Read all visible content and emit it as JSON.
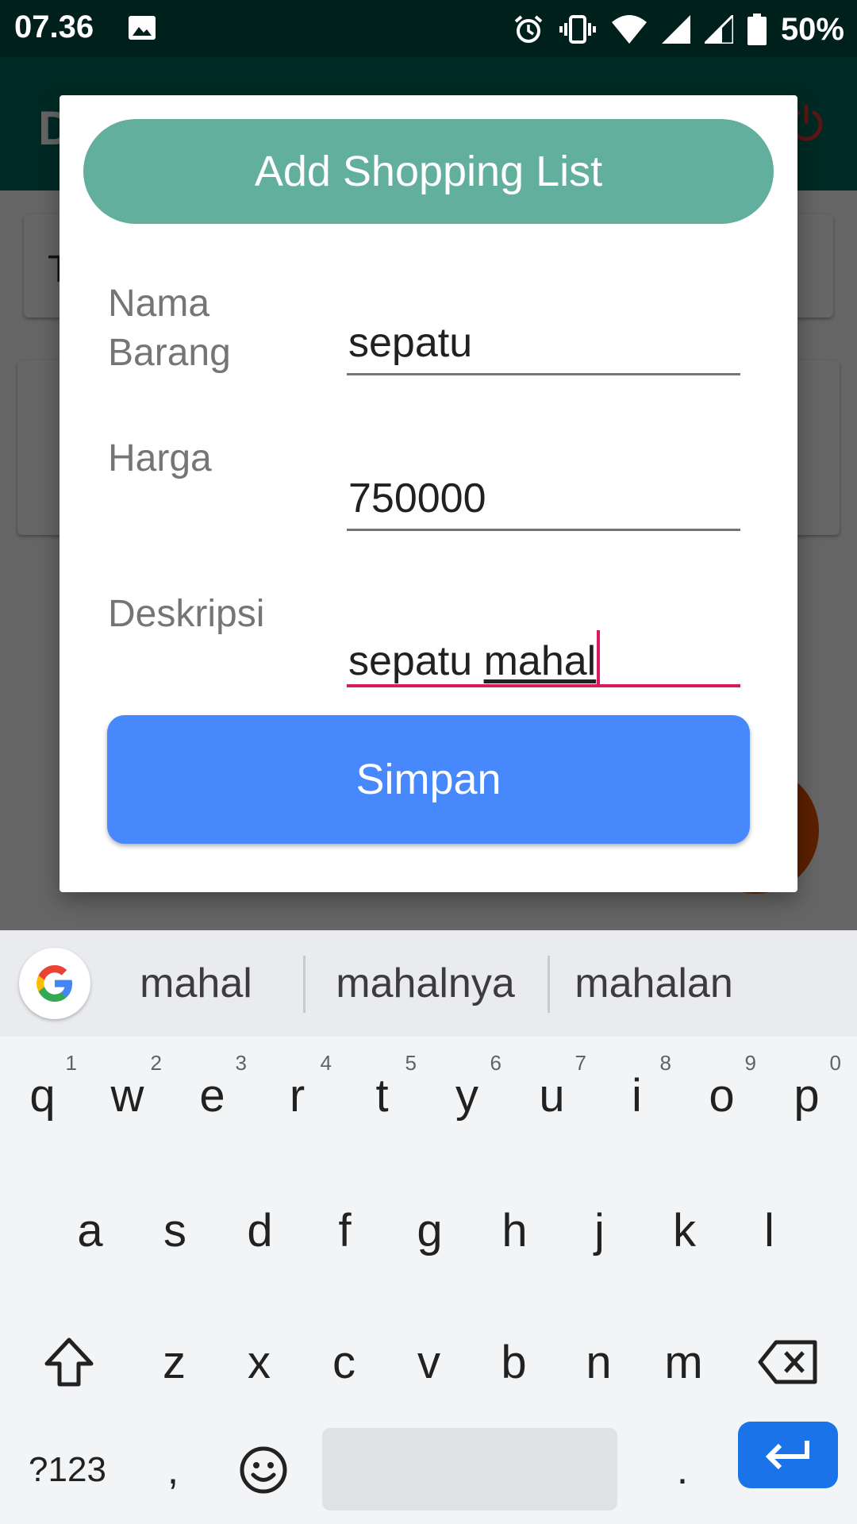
{
  "status_bar": {
    "time": "07.36",
    "battery": "50%",
    "icons": [
      "image-icon",
      "alarm-icon",
      "vibrate-icon",
      "wifi-icon",
      "signal-icon",
      "signal-icon-2",
      "battery-icon"
    ]
  },
  "background_app": {
    "title_partial": "D",
    "card_text_partial": "T",
    "appbar_color": "#00695c",
    "fab_color": "#e65100",
    "power_icon": "power-icon"
  },
  "dialog": {
    "header": "Add Shopping List",
    "fields": [
      {
        "label": "Nama\nBarang",
        "value": "sepatu"
      },
      {
        "label": "Harga",
        "value": "750000"
      },
      {
        "label": "Deskripsi",
        "value_prefix": "sepatu ",
        "value_composing": "mahal"
      }
    ],
    "save_button": "Simpan",
    "header_color": "#62af9d",
    "button_color": "#4788fc",
    "focus_color": "#d81b60"
  },
  "keyboard": {
    "suggestions": [
      "mahal",
      "mahalnya",
      "mahalan"
    ],
    "row1": [
      "q",
      "w",
      "e",
      "r",
      "t",
      "y",
      "u",
      "i",
      "o",
      "p"
    ],
    "row1_hints": [
      "1",
      "2",
      "3",
      "4",
      "5",
      "6",
      "7",
      "8",
      "9",
      "0"
    ],
    "row2": [
      "a",
      "s",
      "d",
      "f",
      "g",
      "h",
      "j",
      "k",
      "l"
    ],
    "row3": [
      "z",
      "x",
      "c",
      "v",
      "b",
      "n",
      "m"
    ],
    "symbols_key": "?123",
    "comma_key": ",",
    "period_key": ".",
    "enter_color": "#1a73e8"
  }
}
